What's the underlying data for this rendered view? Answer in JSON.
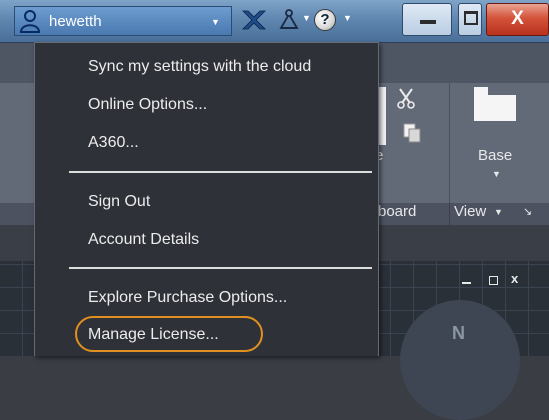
{
  "titlebar": {
    "username": "hewetth",
    "help_label": "?",
    "close_label": "X"
  },
  "ribbon": {
    "base_label": "Base",
    "clipboard_partial": "board",
    "view_label": "View",
    "partial_e": "e"
  },
  "menu": {
    "items": [
      {
        "label": "Sync my settings with the cloud"
      },
      {
        "label": "Online Options..."
      },
      {
        "label": "A360..."
      },
      {
        "label": "Sign Out"
      },
      {
        "label": "Account Details"
      },
      {
        "label": "Explore Purchase Options..."
      },
      {
        "label": "Manage License..."
      }
    ],
    "highlighted": "Manage License...",
    "highlight_color": "#e09020"
  },
  "viewport": {
    "compass_label": "N"
  },
  "colors": {
    "titlebar": "#5f87b0",
    "menu_bg": "#2f3138",
    "close_button": "#d4533a"
  }
}
